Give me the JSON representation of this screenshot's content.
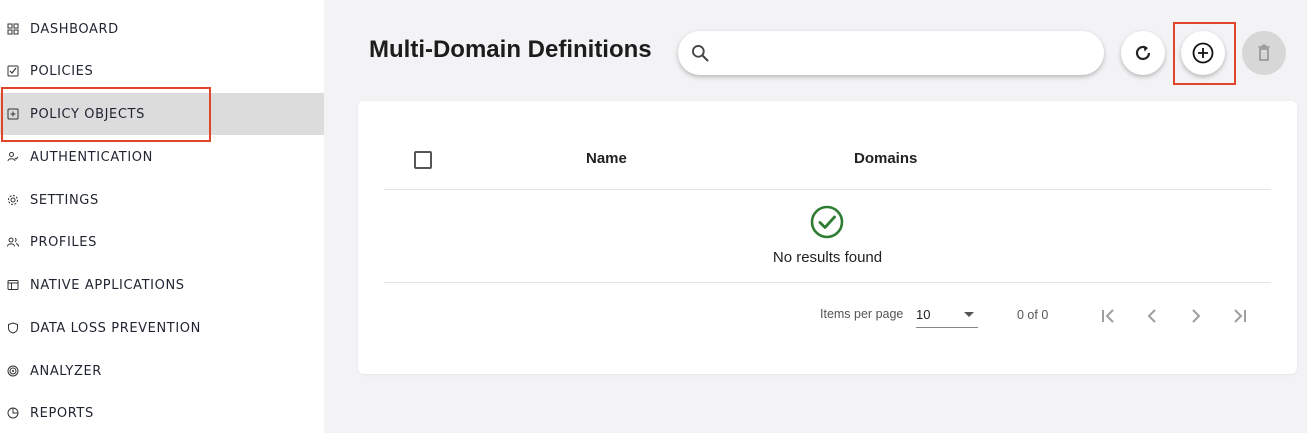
{
  "sidebar": {
    "items": [
      {
        "label": "DASHBOARD",
        "icon": "dashboard-icon"
      },
      {
        "label": "POLICIES",
        "icon": "checklist-icon"
      },
      {
        "label": "POLICY OBJECTS",
        "icon": "plus-box-icon",
        "active": true
      },
      {
        "label": "AUTHENTICATION",
        "icon": "user-check-icon"
      },
      {
        "label": "SETTINGS",
        "icon": "gear-icon"
      },
      {
        "label": "PROFILES",
        "icon": "users-icon"
      },
      {
        "label": "NATIVE APPLICATIONS",
        "icon": "window-icon"
      },
      {
        "label": "DATA LOSS PREVENTION",
        "icon": "shield-icon"
      },
      {
        "label": "ANALYZER",
        "icon": "target-icon"
      },
      {
        "label": "REPORTS",
        "icon": "pie-chart-icon"
      }
    ]
  },
  "header": {
    "title": "Multi-Domain Definitions",
    "search": {
      "placeholder": "",
      "value": ""
    }
  },
  "table": {
    "columns": [
      "Name",
      "Domains"
    ],
    "empty_message": "No results found"
  },
  "pagination": {
    "items_per_page_label": "Items per page",
    "items_per_page_value": "10",
    "range_label": "0 of 0"
  },
  "colors": {
    "accent_highlight": "#e0452c",
    "success_green": "#2e7d32",
    "active_nav_bg": "#dcdcdc"
  }
}
